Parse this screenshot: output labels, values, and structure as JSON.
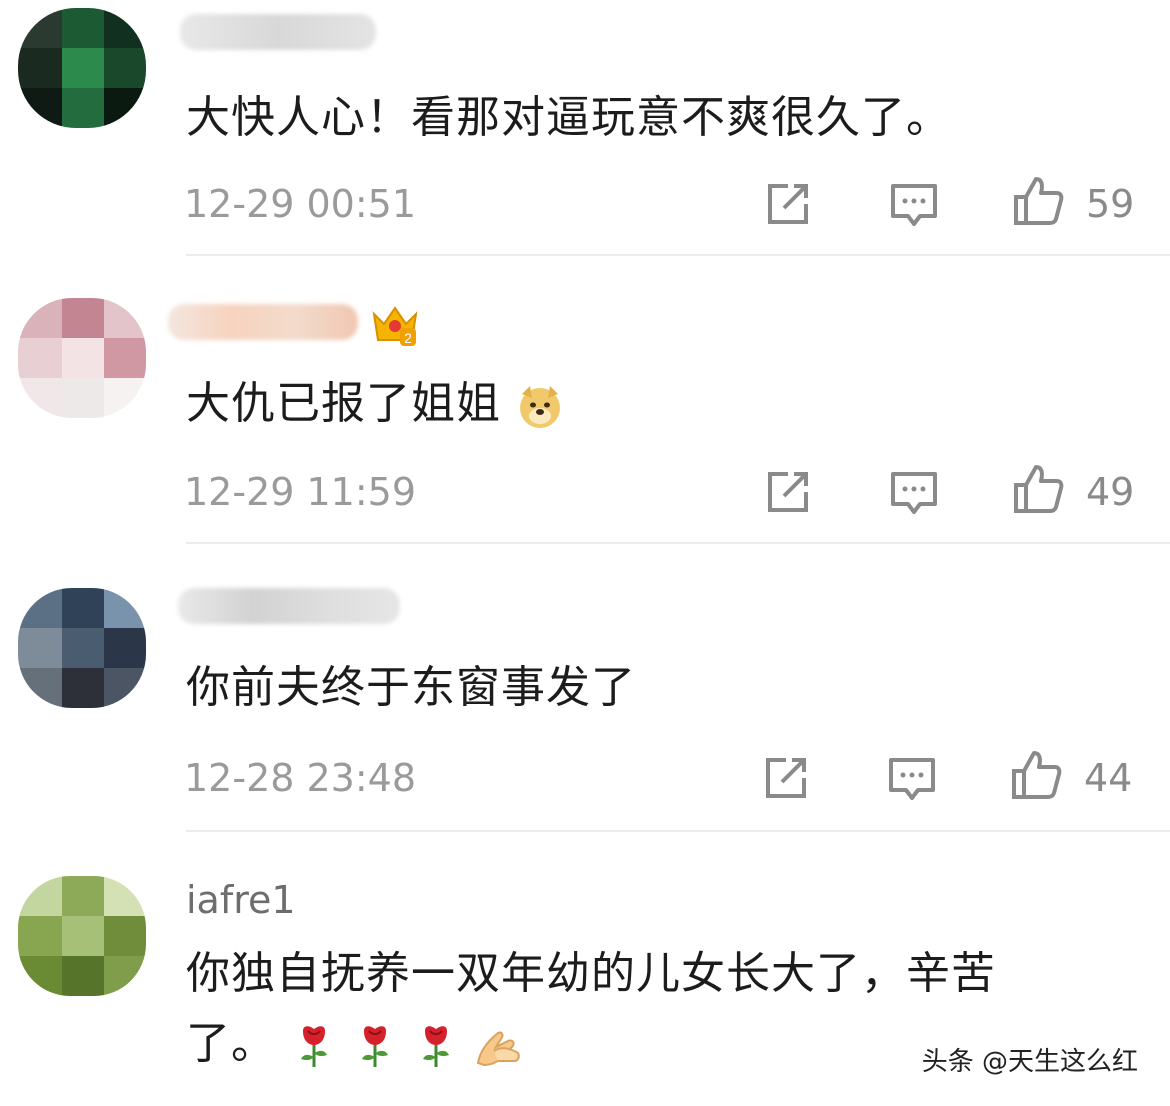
{
  "comments": [
    {
      "username": "",
      "text": "大快人心！看那对逼玩意不爽很久了。",
      "time": "12-29 00:51",
      "likes": "59",
      "colors": [
        "#1f3a2a",
        "#2c7a46",
        "#0f2418"
      ]
    },
    {
      "username": "",
      "text": "大仇已报了姐姐",
      "time": "12-29 11:59",
      "likes": "49",
      "badge": "crown-2-icon",
      "trailing_emoji": "doge-emoji-icon",
      "colors": [
        "#c78b95",
        "#f3d9dc",
        "#e9e4e4"
      ]
    },
    {
      "username": "",
      "text": "你前夫终于东窗事发了",
      "time": "12-28 23:48",
      "likes": "44",
      "colors": [
        "#445566",
        "#7a8fa6",
        "#2a3341"
      ]
    },
    {
      "username": "iafre1",
      "text_line1": "你独自抚养一双年幼的儿女长大了，辛苦",
      "text_line2": "了。",
      "trailing_emojis": [
        "rose-icon",
        "rose-icon",
        "rose-icon",
        "pray-hands-icon"
      ],
      "colors": [
        "#7b9a42",
        "#b8cf86",
        "#55752b"
      ]
    }
  ],
  "watermark": "头条 @天生这么红"
}
